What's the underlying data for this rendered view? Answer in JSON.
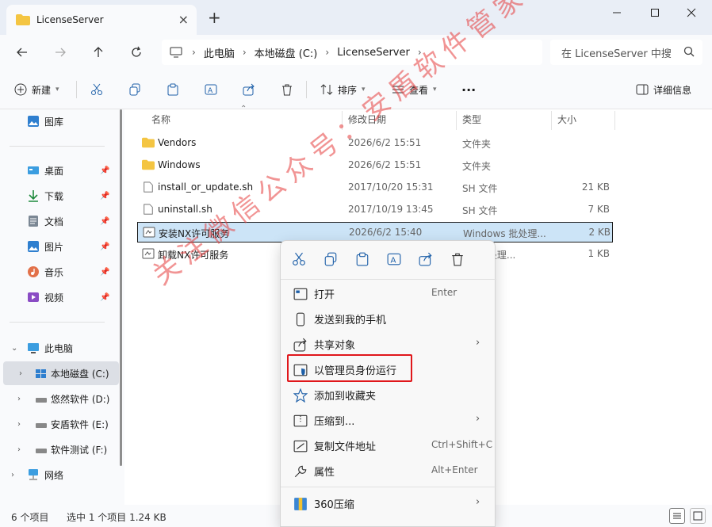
{
  "window": {
    "tab_title": "LicenseServer",
    "new_tab": "+"
  },
  "address": {
    "crumbs": [
      "此电脑",
      "本地磁盘 (C:)",
      "LicenseServer"
    ],
    "search_placeholder": "在 LicenseServer 中搜"
  },
  "toolbar": {
    "new_label": "新建",
    "sort_label": "排序",
    "view_label": "查看",
    "more_label": "···",
    "details_label": "详细信息"
  },
  "sidebar": {
    "items": [
      {
        "label": "图库"
      },
      {
        "label": "桌面"
      },
      {
        "label": "下载"
      },
      {
        "label": "文档"
      },
      {
        "label": "图片"
      },
      {
        "label": "音乐"
      },
      {
        "label": "视频"
      },
      {
        "label": "此电脑"
      },
      {
        "label": "本地磁盘 (C:)"
      },
      {
        "label": "悠然软件 (D:)"
      },
      {
        "label": "安盾软件 (E:)"
      },
      {
        "label": "软件测试 (F:)"
      },
      {
        "label": "网络"
      }
    ]
  },
  "columns": {
    "name": "名称",
    "date": "修改日期",
    "type": "类型",
    "size": "大小"
  },
  "files": [
    {
      "name": "Vendors",
      "date": "2026/6/2 15:51",
      "type": "文件夹",
      "size": ""
    },
    {
      "name": "Windows",
      "date": "2026/6/2 15:51",
      "type": "文件夹",
      "size": ""
    },
    {
      "name": "install_or_update.sh",
      "date": "2017/10/20 15:31",
      "type": "SH 文件",
      "size": "21 KB"
    },
    {
      "name": "uninstall.sh",
      "date": "2017/10/19 13:45",
      "type": "SH 文件",
      "size": "7 KB"
    },
    {
      "name": "安装NX许可服务",
      "date": "2026/6/2 15:40",
      "type": "Windows 批处理...",
      "size": "2 KB"
    },
    {
      "name": "卸载NX许可服务",
      "date": "",
      "type": "ws 批处理...",
      "size": "1 KB"
    }
  ],
  "context_menu": {
    "items": [
      {
        "label": "打开",
        "shortcut": "Enter"
      },
      {
        "label": "发送到我的手机",
        "shortcut": ""
      },
      {
        "label": "共享对象",
        "shortcut": ""
      },
      {
        "label": "以管理员身份运行",
        "shortcut": ""
      },
      {
        "label": "添加到收藏夹",
        "shortcut": ""
      },
      {
        "label": "压缩到...",
        "shortcut": ""
      },
      {
        "label": "复制文件地址",
        "shortcut": "Ctrl+Shift+C"
      },
      {
        "label": "属性",
        "shortcut": "Alt+Enter"
      },
      {
        "label": "360压缩",
        "shortcut": ""
      }
    ]
  },
  "status": {
    "count": "6 个项目",
    "selected": "选中 1 个项目  1.24 KB"
  },
  "watermark": "关注微信公众号：安盾软件管家",
  "colors": {
    "accent": "#0067c0",
    "selection": "#cce4f7",
    "highlight_box": "#e0171b"
  }
}
